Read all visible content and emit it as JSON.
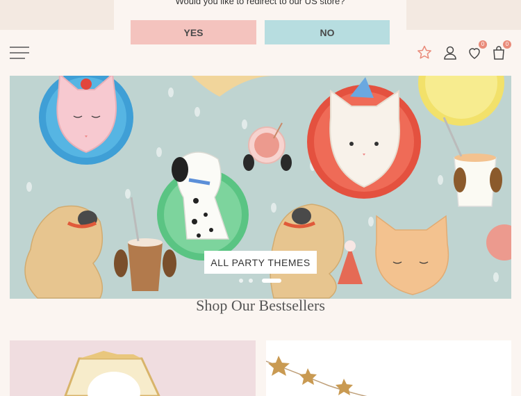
{
  "redirect": {
    "question": "Would you like to redirect to our US store?",
    "yes_label": "YES",
    "no_label": "NO"
  },
  "header": {
    "wishlist_count": "0",
    "cart_count": "0"
  },
  "hero": {
    "cta_label": "ALL PARTY THEMES",
    "slide_count": 3,
    "active_slide": 3
  },
  "bestsellers": {
    "title": "Shop Our Bestsellers"
  },
  "colors": {
    "yes": "#f4c3be",
    "no": "#b7dde0",
    "badge": "#e98b7a",
    "star": "#e98b7a"
  }
}
